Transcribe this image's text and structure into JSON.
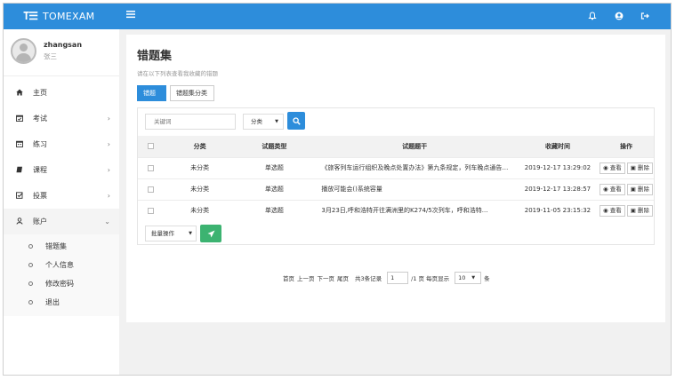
{
  "app": {
    "logo_mark": "T☰",
    "logo_text": "TOMEXAM"
  },
  "topbar": {
    "menu_icon": "menu-icon",
    "icons": [
      "bell-icon",
      "user-circle-icon",
      "sign-out-icon"
    ]
  },
  "user": {
    "username": "zhangsan",
    "nickname": "张三"
  },
  "nav": [
    {
      "label": "主页",
      "icon": "home-icon",
      "has_children": false
    },
    {
      "label": "考试",
      "icon": "calendar-check-icon",
      "has_children": true
    },
    {
      "label": "练习",
      "icon": "calendar-icon",
      "has_children": true
    },
    {
      "label": "课程",
      "icon": "book-icon",
      "has_children": true
    },
    {
      "label": "投票",
      "icon": "checkbox-icon",
      "has_children": true
    },
    {
      "label": "账户",
      "icon": "user-icon",
      "has_children": true,
      "expanded": true
    }
  ],
  "subnav": [
    "错题集",
    "个人信息",
    "修改密码",
    "退出"
  ],
  "page": {
    "title": "错题集",
    "subtitle": "请在以下列表查看我收藏的错题",
    "tabs": [
      "错题集",
      "错题集分类"
    ]
  },
  "filter": {
    "keyword_placeholder": "关键词",
    "category_select": "分类"
  },
  "table": {
    "headers": [
      "分类",
      "试题类型",
      "试题题干",
      "收藏时间",
      "操作"
    ],
    "rows": [
      {
        "category": "未分类",
        "type": "单选题",
        "question": "《旅客列车运行组织及晚点处置办法》第九条规定，列车晚点通告用...",
        "time": "2019-12-17 13:29:02"
      },
      {
        "category": "未分类",
        "type": "单选题",
        "question": "播放可能会()系统容量",
        "time": "2019-12-17 13:28:57"
      },
      {
        "category": "未分类",
        "type": "单选题",
        "question": "3月23日,呼和浩特开往满洲里的K274/5次列车，呼和浩特...",
        "time": "2019-11-05 23:15:32"
      }
    ],
    "view_label": "查看",
    "delete_label": "删除"
  },
  "batch": {
    "label": "批量操作"
  },
  "pager": {
    "first": "首页",
    "prev": "上一页",
    "next": "下一页",
    "last": "尾页",
    "total": "共3条记录",
    "page_value": "1",
    "pages_text": "/1 页 每页显示",
    "size_value": "10",
    "unit": "条"
  },
  "colors": {
    "primary": "#2d8ddb",
    "success": "#3cb371",
    "sidebar_bg": "#ffffff",
    "page_bg": "#f1f1f1"
  }
}
